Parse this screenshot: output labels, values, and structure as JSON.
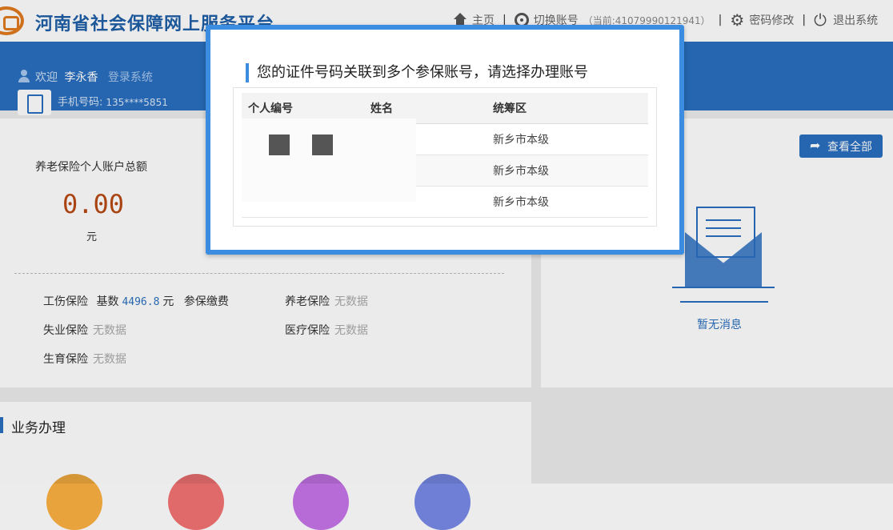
{
  "header": {
    "site_title": "河南省社会保障网上服务平台",
    "nav": [
      {
        "label": "主页",
        "icon": "home-icon"
      },
      {
        "label": "切换账号",
        "icon": "switch-account-icon",
        "current": "（当前:41079990121941）"
      },
      {
        "label": "密码修改",
        "icon": "gear-icon"
      },
      {
        "label": "退出系统",
        "icon": "power-icon"
      }
    ],
    "separator": "|"
  },
  "user": {
    "welcome": "欢迎",
    "name": "李永香",
    "login_text": "登录系统",
    "phone_label": "手机号码:",
    "phone_value": "135****5851"
  },
  "account_summary": {
    "label": "养老保险个人账户总额",
    "amount": "0.00",
    "unit": "元"
  },
  "insurance": {
    "work_injury": {
      "label": "工伤保险",
      "base_label": "基数",
      "base_value": "4496.8",
      "unit": "元",
      "status": "参保缴费"
    },
    "pension": {
      "label": "养老保险",
      "status": "无数据"
    },
    "unemployment": {
      "label": "失业保险",
      "status": "无数据"
    },
    "medical": {
      "label": "医疗保险",
      "status": "无数据"
    },
    "maternity": {
      "label": "生育保险",
      "status": "无数据"
    }
  },
  "messages": {
    "view_all_label": "查看全部",
    "empty_text": "暂无消息"
  },
  "business": {
    "title": "业务办理",
    "circle_colors": [
      "#e8a33c",
      "#e06a6a",
      "#b76bd6",
      "#6f7fd6"
    ]
  },
  "modal": {
    "title": "您的证件号码关联到多个参保账号，请选择办理账号",
    "columns": [
      "个人编号",
      "姓名",
      "统筹区"
    ],
    "rows": [
      {
        "id": "",
        "name": "",
        "region": "新乡市本级"
      },
      {
        "id": "",
        "name": "",
        "region": "新乡市本级"
      },
      {
        "id": "",
        "name": "",
        "region": "新乡市本级"
      }
    ]
  },
  "colors": {
    "brand_blue": "#2a6fbf",
    "modal_border": "#3a8de0",
    "amount_color": "#b84a14"
  }
}
